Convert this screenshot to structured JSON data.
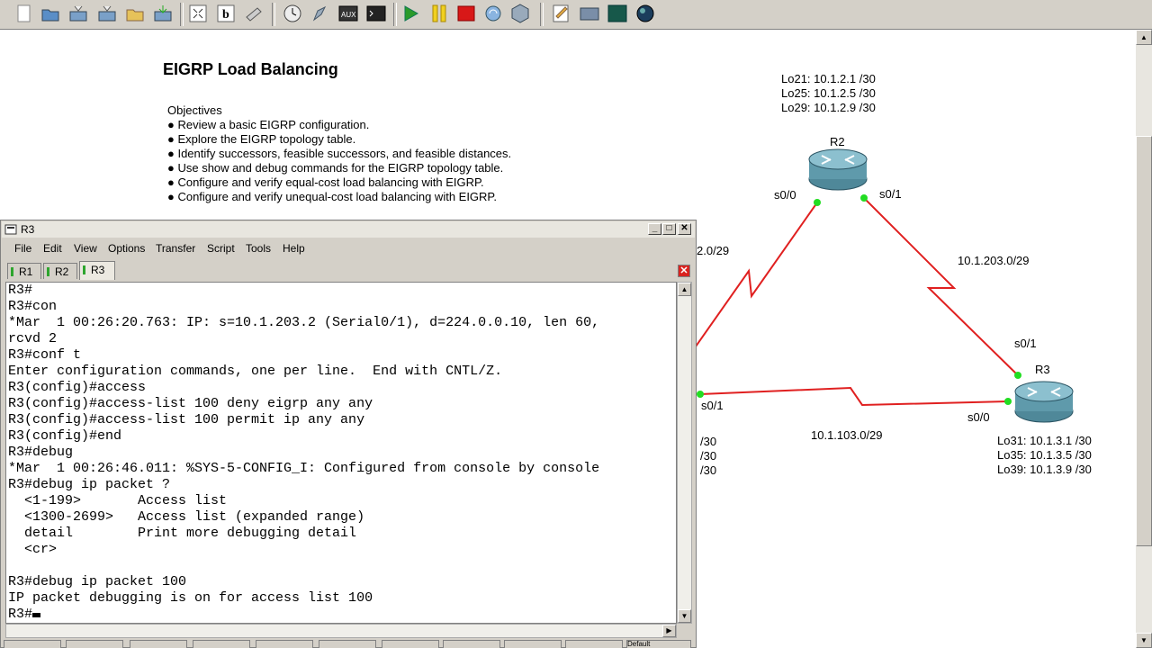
{
  "toolbar": {
    "icons": [
      "new-icon",
      "open-icon",
      "save-icon",
      "save-as-icon",
      "open-folder-icon",
      "export-icon",
      "snapshot-icon",
      "label-icon",
      "note-icon",
      "clock-icon",
      "rocket-icon",
      "aux-icon",
      "console-icon",
      "start-icon",
      "pause-icon",
      "stop-icon",
      "reload-icon",
      "virtualbox-icon",
      "edit-icon",
      "screenshot-icon",
      "terminal-icon",
      "globe-icon"
    ],
    "aux_label": "AUX"
  },
  "lab": {
    "title": "EIGRP Load Balancing",
    "objectives_heading": "Objectives",
    "objectives": [
      "● Review a basic EIGRP configuration.",
      "● Explore the EIGRP topology table.",
      "● Identify successors, feasible successors, and feasible distances.",
      "● Use show and debug commands for the EIGRP topology table.",
      "● Configure and verify equal-cost load balancing with EIGRP.",
      "● Configure and verify unequal-cost load balancing with EIGRP."
    ]
  },
  "topology": {
    "r2_loopbacks": [
      "Lo21: 10.1.2.1 /30",
      "Lo25: 10.1.2.5 /30",
      "Lo29: 10.1.2.9 /30"
    ],
    "r2_name": "R2",
    "r2_s00": "s0/0",
    "r2_s01": "s0/1",
    "link_r1_r2": "2.0/29",
    "link_r2_r3": "10.1.203.0/29",
    "r3_s01": "s0/1",
    "r3_name": "R3",
    "r3_s00": "s0/0",
    "r1_s01": "s0/1",
    "link_r1_r3": "10.1.103.0/29",
    "r3_loopbacks": [
      "Lo31: 10.1.3.1 /30",
      "Lo35: 10.1.3.5 /30",
      "Lo39: 10.1.3.9 /30"
    ],
    "r1_loopbacks_partial": [
      "/30",
      "/30",
      "/30"
    ],
    "link_color": "#e02020",
    "port_color": "#22dd22"
  },
  "terminal": {
    "title": "R3",
    "menu": [
      "File",
      "Edit",
      "View",
      "Options",
      "Transfer",
      "Script",
      "Tools",
      "Help"
    ],
    "tabs": [
      "R1",
      "R2",
      "R3"
    ],
    "active_tab": "R3",
    "lines": [
      "R3#",
      "R3#con",
      "*Mar  1 00:26:20.763: IP: s=10.1.203.2 (Serial0/1), d=224.0.0.10, len 60,",
      "rcvd 2",
      "R3#conf t",
      "Enter configuration commands, one per line.  End with CNTL/Z.",
      "R3(config)#access",
      "R3(config)#access-list 100 deny eigrp any any",
      "R3(config)#access-list 100 permit ip any any",
      "R3(config)#end",
      "R3#debug",
      "*Mar  1 00:26:46.011: %SYS-5-CONFIG_I: Configured from console by console",
      "R3#debug ip packet ?",
      "  <1-199>       Access list",
      "  <1300-2699>   Access list (expanded range)",
      "  detail        Print more debugging detail",
      "  <cr>",
      "",
      "R3#debug ip packet 100",
      "IP packet debugging is on for access list 100"
    ],
    "prompt": "R3#",
    "status_partial": "Default"
  }
}
